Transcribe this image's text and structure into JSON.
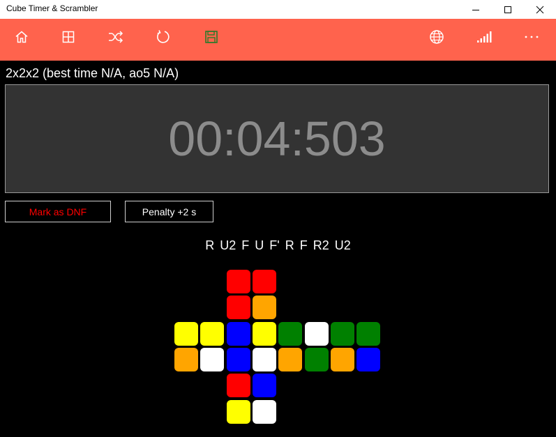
{
  "window": {
    "title": "Cube Timer & Scrambler"
  },
  "toolbar": {
    "colors": {
      "background": "#ff634d",
      "icon": "#ffffff",
      "save_icon": "#2a7a2a"
    },
    "left_buttons": [
      "home-icon",
      "grid-icon",
      "shuffle-icon",
      "refresh-icon",
      "save-icon"
    ],
    "right_buttons": [
      "globe-icon",
      "signal-bars-icon",
      "more-icon"
    ]
  },
  "puzzle": {
    "header": "2x2x2 (best time N/A, ao5 N/A)"
  },
  "timer": {
    "display": "00:04:503"
  },
  "actions": {
    "dnf_label": "Mark as DNF",
    "penalty_label": "Penalty +2 s"
  },
  "scramble": {
    "moves": [
      "R",
      "U2",
      "F",
      "U",
      "F'",
      "R",
      "F",
      "R2",
      "U2"
    ]
  },
  "cube_net": {
    "colors": {
      "R": "#ff0000",
      "O": "#ffa500",
      "Y": "#ffff00",
      "B": "#0000ff",
      "G": "#008000",
      "W": "#ffffff"
    },
    "rows": [
      [
        "",
        "",
        "R",
        "R",
        "",
        "",
        "",
        ""
      ],
      [
        "",
        "",
        "R",
        "O",
        "",
        "",
        "",
        ""
      ],
      [
        "Y",
        "Y",
        "B",
        "Y",
        "G",
        "W",
        "G",
        "G"
      ],
      [
        "O",
        "W",
        "B",
        "W",
        "O",
        "G",
        "O",
        "B"
      ],
      [
        "",
        "",
        "R",
        "B",
        "",
        "",
        "",
        ""
      ],
      [
        "",
        "",
        "Y",
        "W",
        "",
        "",
        "",
        ""
      ]
    ]
  }
}
